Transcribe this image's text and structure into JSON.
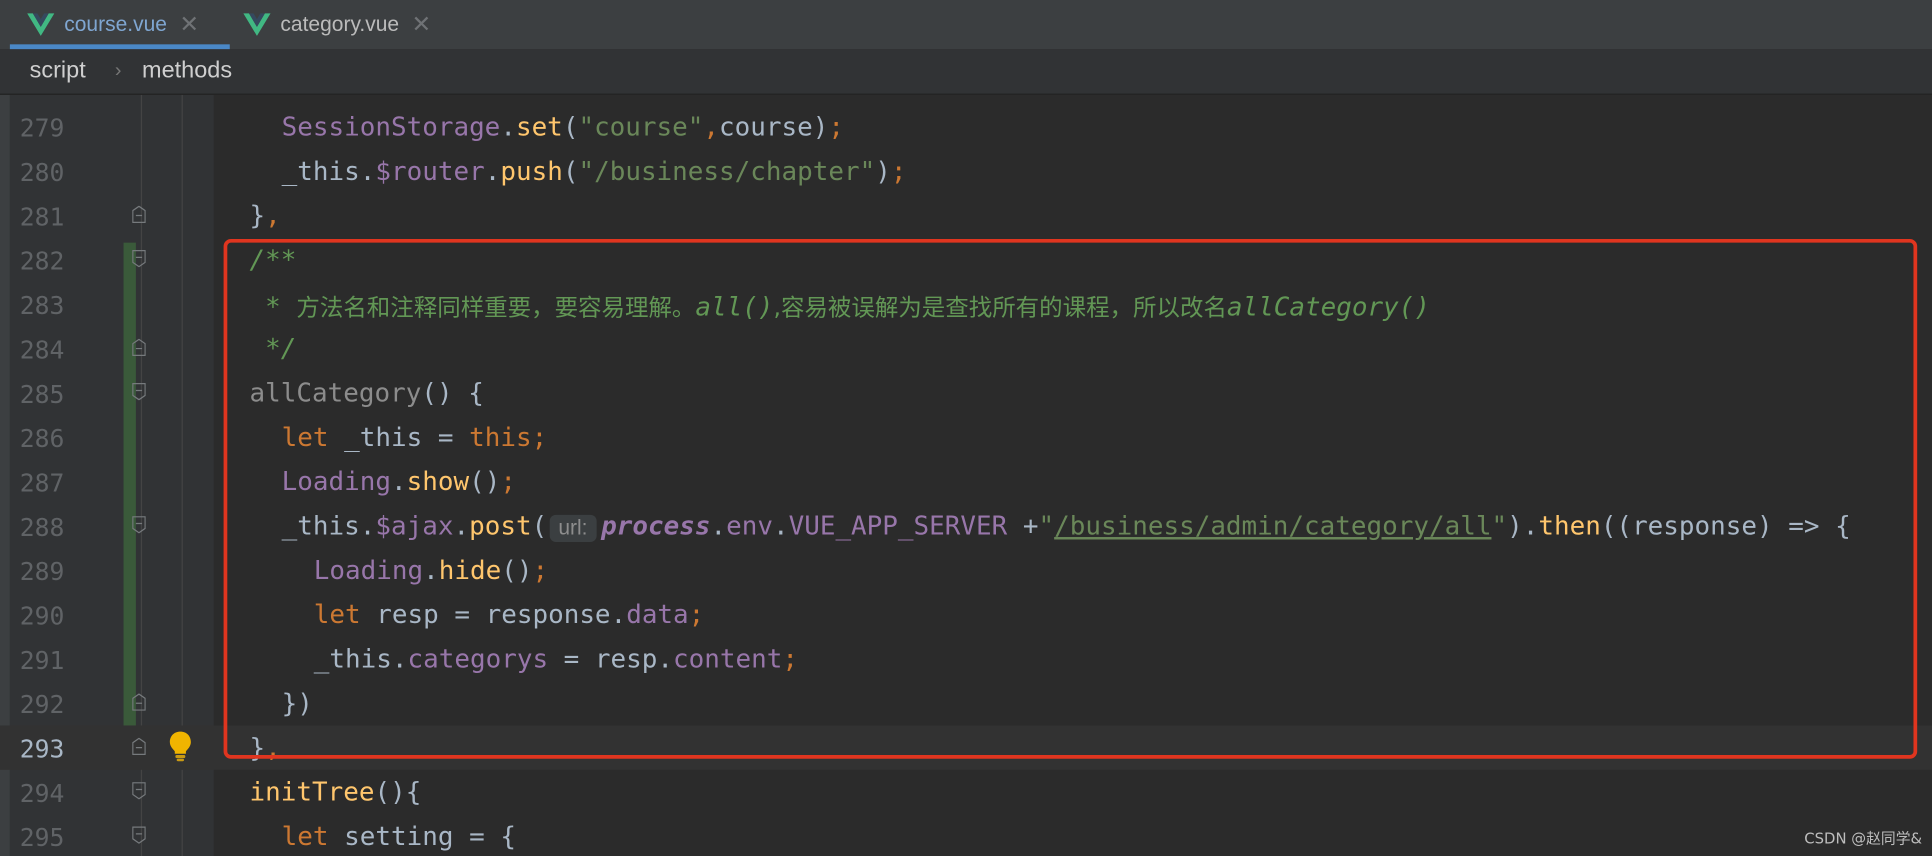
{
  "tabs": [
    {
      "label": "course.vue",
      "active": true,
      "icon": "vue-logo-icon"
    },
    {
      "label": "category.vue",
      "active": false,
      "icon": "vue-logo-icon"
    }
  ],
  "breadcrumb": {
    "items": [
      "script",
      "methods"
    ]
  },
  "editor": {
    "current_line": 293,
    "lines": [
      {
        "no": "279"
      },
      {
        "no": "280"
      },
      {
        "no": "281"
      },
      {
        "no": "282"
      },
      {
        "no": "283"
      },
      {
        "no": "284"
      },
      {
        "no": "285"
      },
      {
        "no": "286"
      },
      {
        "no": "287"
      },
      {
        "no": "288"
      },
      {
        "no": "289"
      },
      {
        "no": "290"
      },
      {
        "no": "291"
      },
      {
        "no": "292"
      },
      {
        "no": "293"
      },
      {
        "no": "294"
      },
      {
        "no": "295"
      }
    ],
    "tokens": {
      "l279": {
        "cls": "SessionStorage",
        "fn": "set",
        "str": "\"course\"",
        "arg": "course"
      },
      "l280": {
        "obj": "_this",
        "fld": "$router",
        "fn": "push",
        "str": "\"/business/chapter\""
      },
      "l281": {
        "text": "}"
      },
      "l282": {
        "text": "/**"
      },
      "l283": {
        "star": " * ",
        "zh1": "方法名和注释同样重要，要容易理解。",
        "code1": "all()",
        "zh2": ",容易被误解为是查找所有的课程，所以改名",
        "code2": "allCategory()"
      },
      "l284": {
        "text": " */"
      },
      "l285": {
        "name": "allCategory",
        "rest": "() {"
      },
      "l286": {
        "kw": "let",
        "var": "_this",
        "eq": " = ",
        "kw2": "this"
      },
      "l287": {
        "cls": "Loading",
        "fn": "show"
      },
      "l288": {
        "obj": "_this",
        "fld": "$ajax",
        "fn": "post",
        "hint": "url:",
        "proc": "process",
        "env": "env",
        "const": "VUE_APP_SERVER",
        "url": "/business/admin/category/all",
        "then": "then",
        "param": "response"
      },
      "l289": {
        "cls": "Loading",
        "fn": "hide"
      },
      "l290": {
        "kw": "let",
        "var": "resp",
        "obj": "response",
        "fld": "data"
      },
      "l291": {
        "obj": "_this",
        "fld": "categorys",
        "obj2": "resp",
        "fld2": "content"
      },
      "l292": {
        "text": "})"
      },
      "l293": {
        "text": "}"
      },
      "l294": {
        "fn": "initTree",
        "rest": "(){"
      },
      "l295": {
        "kw": "let",
        "var": "setting",
        "rest": " = {"
      }
    }
  },
  "watermark": "CSDN @赵同学&",
  "colors": {
    "highlight_box": "#e0351f",
    "keyword": "#cc7832",
    "string": "#6a8759",
    "function": "#ffc66d",
    "field": "#9876aa",
    "comment": "#629755"
  }
}
